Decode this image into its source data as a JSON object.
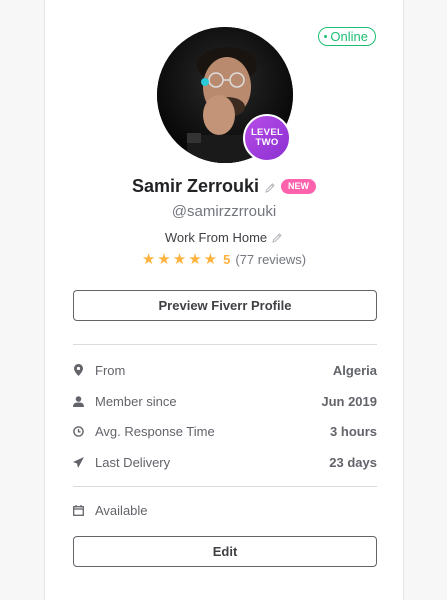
{
  "status": {
    "online_label": "Online"
  },
  "profile": {
    "level_line1": "LEVEL",
    "level_line2": "TWO",
    "name": "Samir Zerrouki",
    "new_badge": "NEW",
    "username": "@samirzzrrouki",
    "tagline": "Work From Home",
    "rating_value": "5",
    "rating_count": "(77 reviews)",
    "stars": 5
  },
  "actions": {
    "preview_label": "Preview Fiverr Profile",
    "edit_label": "Edit"
  },
  "stats": [
    {
      "icon": "location-pin-icon",
      "label": "From",
      "value": "Algeria"
    },
    {
      "icon": "user-icon",
      "label": "Member since",
      "value": "Jun 2019"
    },
    {
      "icon": "clock-icon",
      "label": "Avg. Response Time",
      "value": "3 hours"
    },
    {
      "icon": "paper-plane-icon",
      "label": "Last Delivery",
      "value": "23 days"
    }
  ],
  "availability": {
    "icon": "calendar-icon",
    "label": "Available"
  },
  "colors": {
    "online_green": "#1dbf73",
    "new_pink": "#ff62ad",
    "level_purple": "#a53ee0",
    "star_gold": "#ffb33e"
  }
}
